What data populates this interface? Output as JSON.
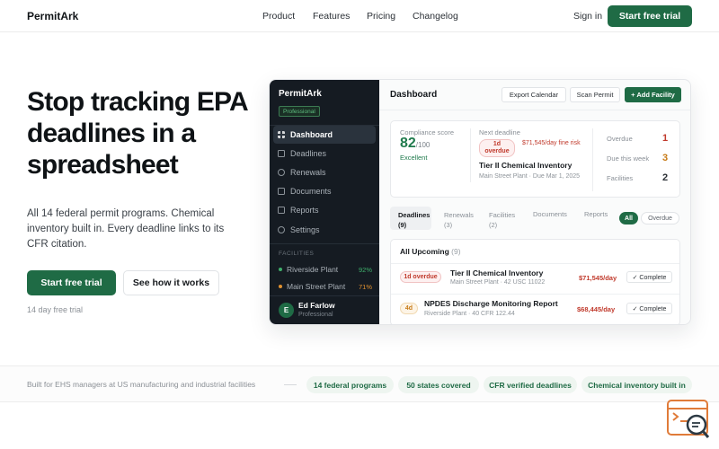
{
  "nav": {
    "brand": "PermitArk",
    "links": [
      "Product",
      "Features",
      "Pricing",
      "Changelog"
    ],
    "sign_in": "Sign in",
    "cta": "Start free trial"
  },
  "hero": {
    "title": "Stop tracking EPA deadlines in a spreadsheet",
    "subtitle": "All 14 federal permit programs. Chemical inventory built in. Every deadline links to its CFR citation.",
    "cta_primary": "Start free trial",
    "cta_secondary": "See how it works",
    "note": "14 day free trial"
  },
  "app": {
    "sidebar": {
      "brand": "PermitArk",
      "plan": "Professional",
      "items": [
        {
          "label": "Dashboard",
          "icon": "grid-icon",
          "active": true
        },
        {
          "label": "Deadlines",
          "icon": "calendar-icon"
        },
        {
          "label": "Renewals",
          "icon": "refresh-icon"
        },
        {
          "label": "Documents",
          "icon": "document-icon"
        },
        {
          "label": "Reports",
          "icon": "chart-icon"
        },
        {
          "label": "Settings",
          "icon": "gear-icon"
        }
      ],
      "facilities_heading": "FACILITIES",
      "facilities": [
        {
          "name": "Riverside Plant",
          "pct": "92%",
          "color": "#3fae6b"
        },
        {
          "name": "Main Street Plant",
          "pct": "71%",
          "color": "#e0912f"
        }
      ],
      "user": {
        "initial": "E",
        "name": "Ed Farlow",
        "role": "Professional"
      }
    },
    "main": {
      "title": "Dashboard",
      "toolbar": {
        "export": "Export Calendar",
        "scan": "Scan Permit",
        "add": "+ Add Facility"
      },
      "score": {
        "label": "Compliance score",
        "value": "82",
        "of": "/100",
        "state": "Excellent"
      },
      "next": {
        "label": "Next deadline",
        "badge": "1d overdue",
        "fine": "$71,545/day fine risk",
        "title": "Tier II Chemical Inventory",
        "meta": "Main Street Plant · Due Mar 1, 2025"
      },
      "stats": [
        {
          "label": "Overdue",
          "value": "1",
          "color": "#c0392b"
        },
        {
          "label": "Due this week",
          "value": "3",
          "color": "#c77a16"
        },
        {
          "label": "Facilities",
          "value": "2",
          "color": "#2c3136"
        }
      ],
      "tabs": [
        {
          "label": "Deadlines",
          "count": "(9)"
        },
        {
          "label": "Renewals",
          "count": "(3)"
        },
        {
          "label": "Facilities",
          "count": "(2)"
        },
        {
          "label": "Documents",
          "count": ""
        },
        {
          "label": "Reports",
          "count": ""
        }
      ],
      "filters": {
        "all": "All",
        "overdue": "Overdue"
      },
      "list": {
        "heading": "All Upcoming",
        "count": "(9)",
        "rows": [
          {
            "badge": "1d overdue",
            "title": "Tier II Chemical Inventory",
            "meta": "Main Street Plant · 42 USC 11022",
            "fine": "$71,545/day",
            "action": "✓ Complete"
          },
          {
            "badge": "4d",
            "title": "NPDES Discharge Monitoring Report",
            "meta": "Riverside Plant · 40 CFR 122.44",
            "fine": "$68,445/day",
            "action": "✓ Complete"
          }
        ]
      }
    }
  },
  "strip": {
    "text": "Built for EHS managers at US manufacturing and industrial facilities",
    "tags": [
      "14 federal programs",
      "50 states covered",
      "CFR verified deadlines",
      "Chemical inventory built in"
    ]
  },
  "colors": {
    "brand_green": "#1f6b45",
    "danger": "#c0392b",
    "warning": "#c77a16",
    "sidebar_bg": "#151b22"
  }
}
